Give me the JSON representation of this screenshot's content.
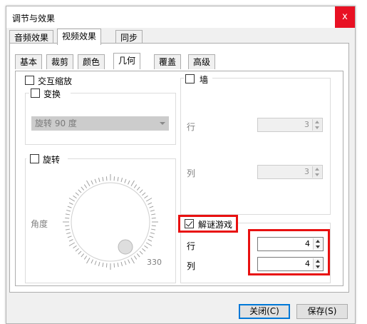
{
  "window": {
    "title": "调节与效果",
    "close_glyph": "x"
  },
  "top_tabs": [
    {
      "label": "音频效果"
    },
    {
      "label": "视频效果"
    },
    {
      "label": "同步"
    }
  ],
  "sub_tabs": [
    {
      "label": "基本"
    },
    {
      "label": "裁剪"
    },
    {
      "label": "颜色"
    },
    {
      "label": "几何"
    },
    {
      "label": "覆盖"
    },
    {
      "label": "高级"
    }
  ],
  "geometry": {
    "interactive_zoom": {
      "label": "交互缩放",
      "checked": false
    },
    "transform": {
      "label": "变换",
      "checked": false,
      "combo_value": "旋转 90 度"
    },
    "rotate": {
      "label": "旋转",
      "checked": false,
      "angle_label": "角度",
      "dial_value": "330"
    },
    "wall": {
      "label": "墙",
      "checked": false,
      "rows_label": "行",
      "rows_value": "3",
      "cols_label": "列",
      "cols_value": "3"
    },
    "puzzle": {
      "label": "解谜游戏",
      "checked": true,
      "rows_label": "行",
      "rows_value": "4",
      "cols_label": "列",
      "cols_value": "4"
    }
  },
  "footer": {
    "close_label": "关闭(C)",
    "save_label": "保存(S)"
  },
  "colors": {
    "highlight": "#e81010",
    "close_bg": "#e81123",
    "disabled_fill": "#cccccc"
  }
}
